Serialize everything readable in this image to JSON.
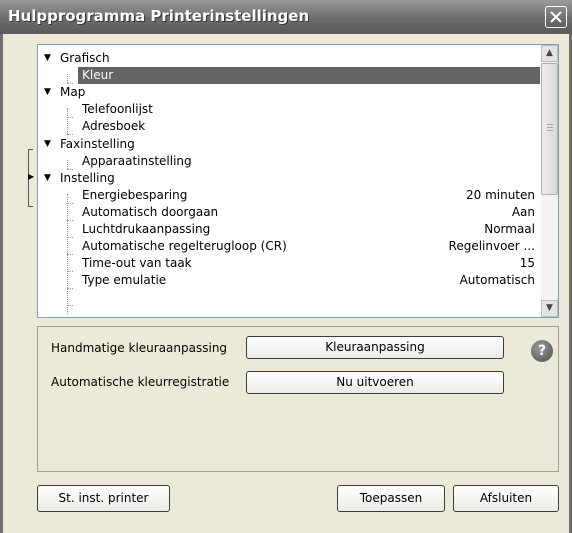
{
  "window": {
    "title": "Hulpprogramma Printerinstellingen"
  },
  "tree": {
    "items": [
      {
        "label": "Grafisch",
        "value": ""
      },
      {
        "label": "Kleur",
        "value": ""
      },
      {
        "label": "Map",
        "value": ""
      },
      {
        "label": "Telefoonlijst",
        "value": ""
      },
      {
        "label": "Adresboek",
        "value": ""
      },
      {
        "label": "Faxinstelling",
        "value": ""
      },
      {
        "label": "Apparaatinstelling",
        "value": ""
      },
      {
        "label": "Instelling",
        "value": ""
      },
      {
        "label": "Energiebesparing",
        "value": "20 minuten"
      },
      {
        "label": "Automatisch doorgaan",
        "value": "Aan"
      },
      {
        "label": "Luchtdrukaanpassing",
        "value": "Normaal"
      },
      {
        "label": "Automatische regelterugloop (CR)",
        "value": "Regelinvoer ..."
      },
      {
        "label": "Time-out van taak",
        "value": "15"
      },
      {
        "label": "Type emulatie",
        "value": "Automatisch"
      }
    ],
    "selected": "Kleur"
  },
  "settings": {
    "manual_color_label": "Handmatige kleuraanpassing",
    "manual_color_button": "Kleuraanpassing",
    "auto_reg_label": "Automatische kleurregistratie",
    "auto_reg_button": "Nu uitvoeren"
  },
  "footer": {
    "status_button": "St. inst. printer",
    "apply_button": "Toepassen",
    "close_button": "Afsluiten"
  },
  "icons": {
    "close": "close-icon",
    "help": "help-icon",
    "expand": "triangle-down-icon",
    "scroll_up": "chevron-up-icon",
    "scroll_down": "chevron-down-icon"
  }
}
